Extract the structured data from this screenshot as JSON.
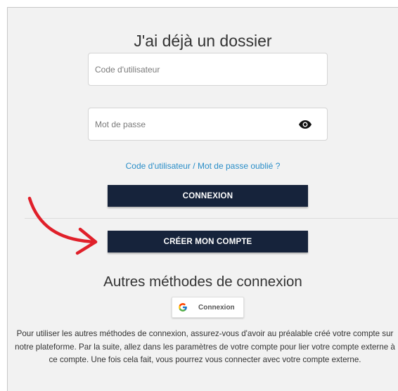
{
  "login": {
    "title": "J'ai déjà un dossier",
    "user_code_placeholder": "Code d'utilisateur",
    "password_placeholder": "Mot de passe",
    "forgot_link": "Code d'utilisateur / Mot de passe oublié ?",
    "connect_button": "CONNEXION",
    "create_account_button": "CRÉER MON COMPTE"
  },
  "other_methods": {
    "title": "Autres méthodes de connexion",
    "google_button": "Connexion",
    "info_text": "Pour utiliser les autres méthodes de connexion, assurez-vous d'avoir au préalable créé votre compte sur notre plateforme. Par la suite, allez dans les paramètres de votre compte pour lier votre compte externe à ce compte. Une fois cela fait, vous pourrez vous connecter avec votre compte externe."
  },
  "icons": {
    "password_toggle": "eye-icon",
    "google": "google-icon",
    "annotation": "red-arrow-icon"
  },
  "colors": {
    "primary_button": "#16233b",
    "link": "#2a8ec8",
    "panel_background": "#f2f2f2",
    "annotation_arrow": "#e0202a"
  }
}
